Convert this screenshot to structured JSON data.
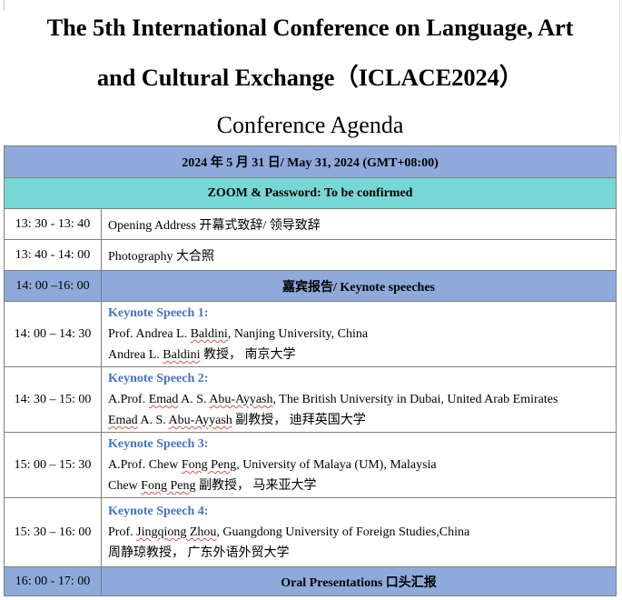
{
  "header": {
    "title_line1": "The 5th International Conference on Language, Art",
    "title_line2": "and Cultural Exchange（ICLACE2024）",
    "subtitle": "Conference Agenda"
  },
  "agenda": {
    "date_bar": "2024 年 5 月 31 日/ May 31, 2024 (GMT+08:00)",
    "zoom_bar": "ZOOM & Password: To be confirmed",
    "rows": [
      {
        "time": "13: 30 - 13: 40",
        "text": "Opening Address 开幕式致辞/ 领导致辞"
      },
      {
        "time": "13: 40 - 14: 00",
        "text": "Photography 大合照"
      }
    ],
    "keynote_section": {
      "time": "14: 00 –16: 00",
      "label": "嘉宾报告/ Keynote speeches"
    },
    "keynotes": [
      {
        "time": "14: 00 – 14: 30",
        "label": "Keynote Speech 1:",
        "line1_prefix": "Prof. Andrea L. ",
        "line1_mark": "Baldini",
        "line1_suffix": ", Nanjing University, China",
        "line2_prefix": "Andrea L. ",
        "line2_mark": "Baldini",
        "line2_suffix": " 教授， 南京大学"
      },
      {
        "time": "14: 30 – 15: 00",
        "label": "Keynote Speech 2:",
        "line1_prefix": "A.Prof. ",
        "line1_mark": "Emad",
        "line1_mid": " A. S. ",
        "line1_mark2": "Abu-Ayyash",
        "line1_suffix": ", The British University in Dubai, United Arab Emirates",
        "line2_prefix": "",
        "line2_mark": "Emad",
        "line2_mid": " A. S. ",
        "line2_mark2": "Abu-Ayyash",
        "line2_suffix": " 副教授， 迪拜英国大学"
      },
      {
        "time": "15: 00 – 15: 30",
        "label": "Keynote Speech 3:",
        "line1_prefix": "A.Prof. Chew ",
        "line1_mark": "Fong Peng",
        "line1_suffix": ", University of Malaya (UM), Malaysia",
        "line2_prefix": "Chew ",
        "line2_mark": "Fong Peng",
        "line2_suffix": " 副教授， 马来亚大学"
      },
      {
        "time": "15: 30 – 16: 00",
        "label": "Keynote Speech 4:",
        "line1_prefix": "Prof. ",
        "line1_mark": "Jingqiong Zhou",
        "line1_suffix": ", Guangdong University of Foreign Studies,China",
        "line2_text": "周静琼教授， 广东外语外贸大学"
      }
    ],
    "oral_section": {
      "time": "16: 00 - 17: 00",
      "label": "Oral Presentations  口头汇报"
    }
  },
  "colors": {
    "bar_blue": "#8eaadb",
    "bar_teal": "#76d7d4",
    "keynote_label": "#4472c4"
  }
}
